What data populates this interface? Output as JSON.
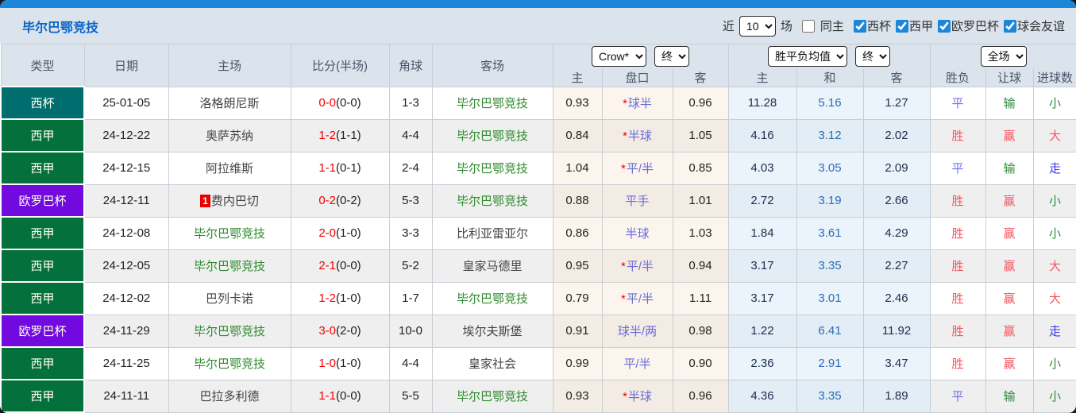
{
  "header": {
    "team_title": "毕尔巴鄂竞技",
    "recent_label": "近",
    "recent_value": "10",
    "matches_label": "场",
    "same_home_label": "同主",
    "same_home_checked": false,
    "filters": [
      {
        "label": "西杯",
        "checked": true
      },
      {
        "label": "西甲",
        "checked": true
      },
      {
        "label": "欧罗巴杯",
        "checked": true
      },
      {
        "label": "球会友谊",
        "checked": true
      }
    ],
    "accent_color": "#1c86d9"
  },
  "controls": {
    "bookmaker_select": "Crow*",
    "bookmaker_time_select": "终",
    "avg_select": "胜平负均值",
    "avg_time_select": "终",
    "scope_select": "全场"
  },
  "table": {
    "columns": [
      "类型",
      "日期",
      "主场",
      "比分(半场)",
      "角球",
      "客场"
    ],
    "sub_columns": [
      "主",
      "盘口",
      "客",
      "主",
      "和",
      "客",
      "胜负",
      "让球",
      "进球数"
    ],
    "type_colors": {
      "西杯": "#006e6f",
      "西甲": "#04703c",
      "欧罗巴杯": "#7209df"
    },
    "rows": [
      {
        "type": "西杯",
        "type_color": "#006e6f",
        "date": "25-01-05",
        "home": "洛格朗尼斯",
        "home_rank": "",
        "home_tracked": false,
        "score_ft": "0-0",
        "score_ht": "(0-0)",
        "corners": "1-3",
        "away": "毕尔巴鄂竞技",
        "away_tracked": true,
        "odds_home": "0.93",
        "handicap_star": true,
        "handicap": "球半",
        "odds_away": "0.96",
        "avg_home": "11.28",
        "avg_draw": "5.16",
        "avg_away": "1.27",
        "result_wdl": "平",
        "result_wdl_color": "blue",
        "result_handicap": "输",
        "result_handicap_color": "green",
        "result_goals": "小",
        "result_goals_color": "green"
      },
      {
        "type": "西甲",
        "type_color": "#04703c",
        "date": "24-12-22",
        "home": "奥萨苏纳",
        "home_rank": "",
        "home_tracked": false,
        "score_ft": "1-2",
        "score_ht": "(1-1)",
        "corners": "4-4",
        "away": "毕尔巴鄂竞技",
        "away_tracked": true,
        "odds_home": "0.84",
        "handicap_star": true,
        "handicap": "半球",
        "odds_away": "1.05",
        "avg_home": "4.16",
        "avg_draw": "3.12",
        "avg_away": "2.02",
        "result_wdl": "胜",
        "result_wdl_color": "red",
        "result_handicap": "赢",
        "result_handicap_color": "red",
        "result_goals": "大",
        "result_goals_color": "red"
      },
      {
        "type": "西甲",
        "type_color": "#04703c",
        "date": "24-12-15",
        "home": "阿拉维斯",
        "home_rank": "",
        "home_tracked": false,
        "score_ft": "1-1",
        "score_ht": "(0-1)",
        "corners": "2-4",
        "away": "毕尔巴鄂竞技",
        "away_tracked": true,
        "odds_home": "1.04",
        "handicap_star": true,
        "handicap": "平/半",
        "odds_away": "0.85",
        "avg_home": "4.03",
        "avg_draw": "3.05",
        "avg_away": "2.09",
        "result_wdl": "平",
        "result_wdl_color": "blue",
        "result_handicap": "输",
        "result_handicap_color": "green",
        "result_goals": "走",
        "result_goals_color": "blue2"
      },
      {
        "type": "欧罗巴杯",
        "type_color": "#7209df",
        "date": "24-12-11",
        "home": "费内巴切",
        "home_rank": "1",
        "home_tracked": false,
        "score_ft": "0-2",
        "score_ht": "(0-2)",
        "corners": "5-3",
        "away": "毕尔巴鄂竞技",
        "away_tracked": true,
        "odds_home": "0.88",
        "handicap_star": false,
        "handicap": "平手",
        "odds_away": "1.01",
        "avg_home": "2.72",
        "avg_draw": "3.19",
        "avg_away": "2.66",
        "result_wdl": "胜",
        "result_wdl_color": "red",
        "result_handicap": "赢",
        "result_handicap_color": "red",
        "result_goals": "小",
        "result_goals_color": "green"
      },
      {
        "type": "西甲",
        "type_color": "#04703c",
        "date": "24-12-08",
        "home": "毕尔巴鄂竞技",
        "home_rank": "",
        "home_tracked": true,
        "score_ft": "2-0",
        "score_ht": "(1-0)",
        "corners": "3-3",
        "away": "比利亚雷亚尔",
        "away_tracked": false,
        "odds_home": "0.86",
        "handicap_star": false,
        "handicap": "半球",
        "odds_away": "1.03",
        "avg_home": "1.84",
        "avg_draw": "3.61",
        "avg_away": "4.29",
        "result_wdl": "胜",
        "result_wdl_color": "red",
        "result_handicap": "赢",
        "result_handicap_color": "red",
        "result_goals": "小",
        "result_goals_color": "green"
      },
      {
        "type": "西甲",
        "type_color": "#04703c",
        "date": "24-12-05",
        "home": "毕尔巴鄂竞技",
        "home_rank": "",
        "home_tracked": true,
        "score_ft": "2-1",
        "score_ht": "(0-0)",
        "corners": "5-2",
        "away": "皇家马德里",
        "away_tracked": false,
        "odds_home": "0.95",
        "handicap_star": true,
        "handicap": "平/半",
        "odds_away": "0.94",
        "avg_home": "3.17",
        "avg_draw": "3.35",
        "avg_away": "2.27",
        "result_wdl": "胜",
        "result_wdl_color": "red",
        "result_handicap": "赢",
        "result_handicap_color": "red",
        "result_goals": "大",
        "result_goals_color": "red"
      },
      {
        "type": "西甲",
        "type_color": "#04703c",
        "date": "24-12-02",
        "home": "巴列卡诺",
        "home_rank": "",
        "home_tracked": false,
        "score_ft": "1-2",
        "score_ht": "(1-0)",
        "corners": "1-7",
        "away": "毕尔巴鄂竞技",
        "away_tracked": true,
        "odds_home": "0.79",
        "handicap_star": true,
        "handicap": "平/半",
        "odds_away": "1.11",
        "avg_home": "3.17",
        "avg_draw": "3.01",
        "avg_away": "2.46",
        "result_wdl": "胜",
        "result_wdl_color": "red",
        "result_handicap": "赢",
        "result_handicap_color": "red",
        "result_goals": "大",
        "result_goals_color": "red"
      },
      {
        "type": "欧罗巴杯",
        "type_color": "#7209df",
        "date": "24-11-29",
        "home": "毕尔巴鄂竞技",
        "home_rank": "",
        "home_tracked": true,
        "score_ft": "3-0",
        "score_ht": "(2-0)",
        "corners": "10-0",
        "away": "埃尔夫斯堡",
        "away_tracked": false,
        "odds_home": "0.91",
        "handicap_star": false,
        "handicap": "球半/两",
        "odds_away": "0.98",
        "avg_home": "1.22",
        "avg_draw": "6.41",
        "avg_away": "11.92",
        "result_wdl": "胜",
        "result_wdl_color": "red",
        "result_handicap": "赢",
        "result_handicap_color": "red",
        "result_goals": "走",
        "result_goals_color": "blue2"
      },
      {
        "type": "西甲",
        "type_color": "#04703c",
        "date": "24-11-25",
        "home": "毕尔巴鄂竞技",
        "home_rank": "",
        "home_tracked": true,
        "score_ft": "1-0",
        "score_ht": "(1-0)",
        "corners": "4-4",
        "away": "皇家社会",
        "away_tracked": false,
        "odds_home": "0.99",
        "handicap_star": false,
        "handicap": "平/半",
        "odds_away": "0.90",
        "avg_home": "2.36",
        "avg_draw": "2.91",
        "avg_away": "3.47",
        "result_wdl": "胜",
        "result_wdl_color": "red",
        "result_handicap": "赢",
        "result_handicap_color": "red",
        "result_goals": "小",
        "result_goals_color": "green"
      },
      {
        "type": "西甲",
        "type_color": "#04703c",
        "date": "24-11-11",
        "home": "巴拉多利德",
        "home_rank": "",
        "home_tracked": false,
        "score_ft": "1-1",
        "score_ht": "(0-0)",
        "corners": "5-5",
        "away": "毕尔巴鄂竞技",
        "away_tracked": true,
        "odds_home": "0.93",
        "handicap_star": true,
        "handicap": "半球",
        "odds_away": "0.96",
        "avg_home": "4.36",
        "avg_draw": "3.35",
        "avg_away": "1.89",
        "result_wdl": "平",
        "result_wdl_color": "blue",
        "result_handicap": "输",
        "result_handicap_color": "green",
        "result_goals": "小",
        "result_goals_color": "green"
      }
    ]
  }
}
